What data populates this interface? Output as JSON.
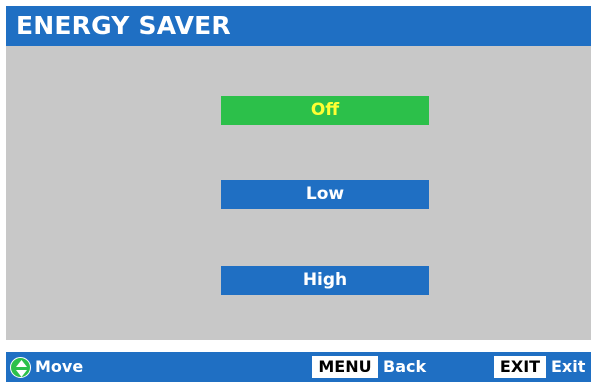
{
  "header": {
    "title": "ENERGY SAVER"
  },
  "options": {
    "off": "Off",
    "low": "Low",
    "high": "High",
    "selected": "Off"
  },
  "footer": {
    "move_icon": "up-down-arrows-icon",
    "move_label": "Move",
    "menu_key": "MENU",
    "menu_label": "Back",
    "exit_key": "EXIT",
    "exit_label": "Exit"
  },
  "colors": {
    "header_bg": "#1f6fc3",
    "body_bg": "#c8c8c8",
    "selected_bg": "#2cc04a",
    "selected_text": "#ffff33",
    "option_bg": "#1f6fc3",
    "option_text": "#ffffff"
  }
}
